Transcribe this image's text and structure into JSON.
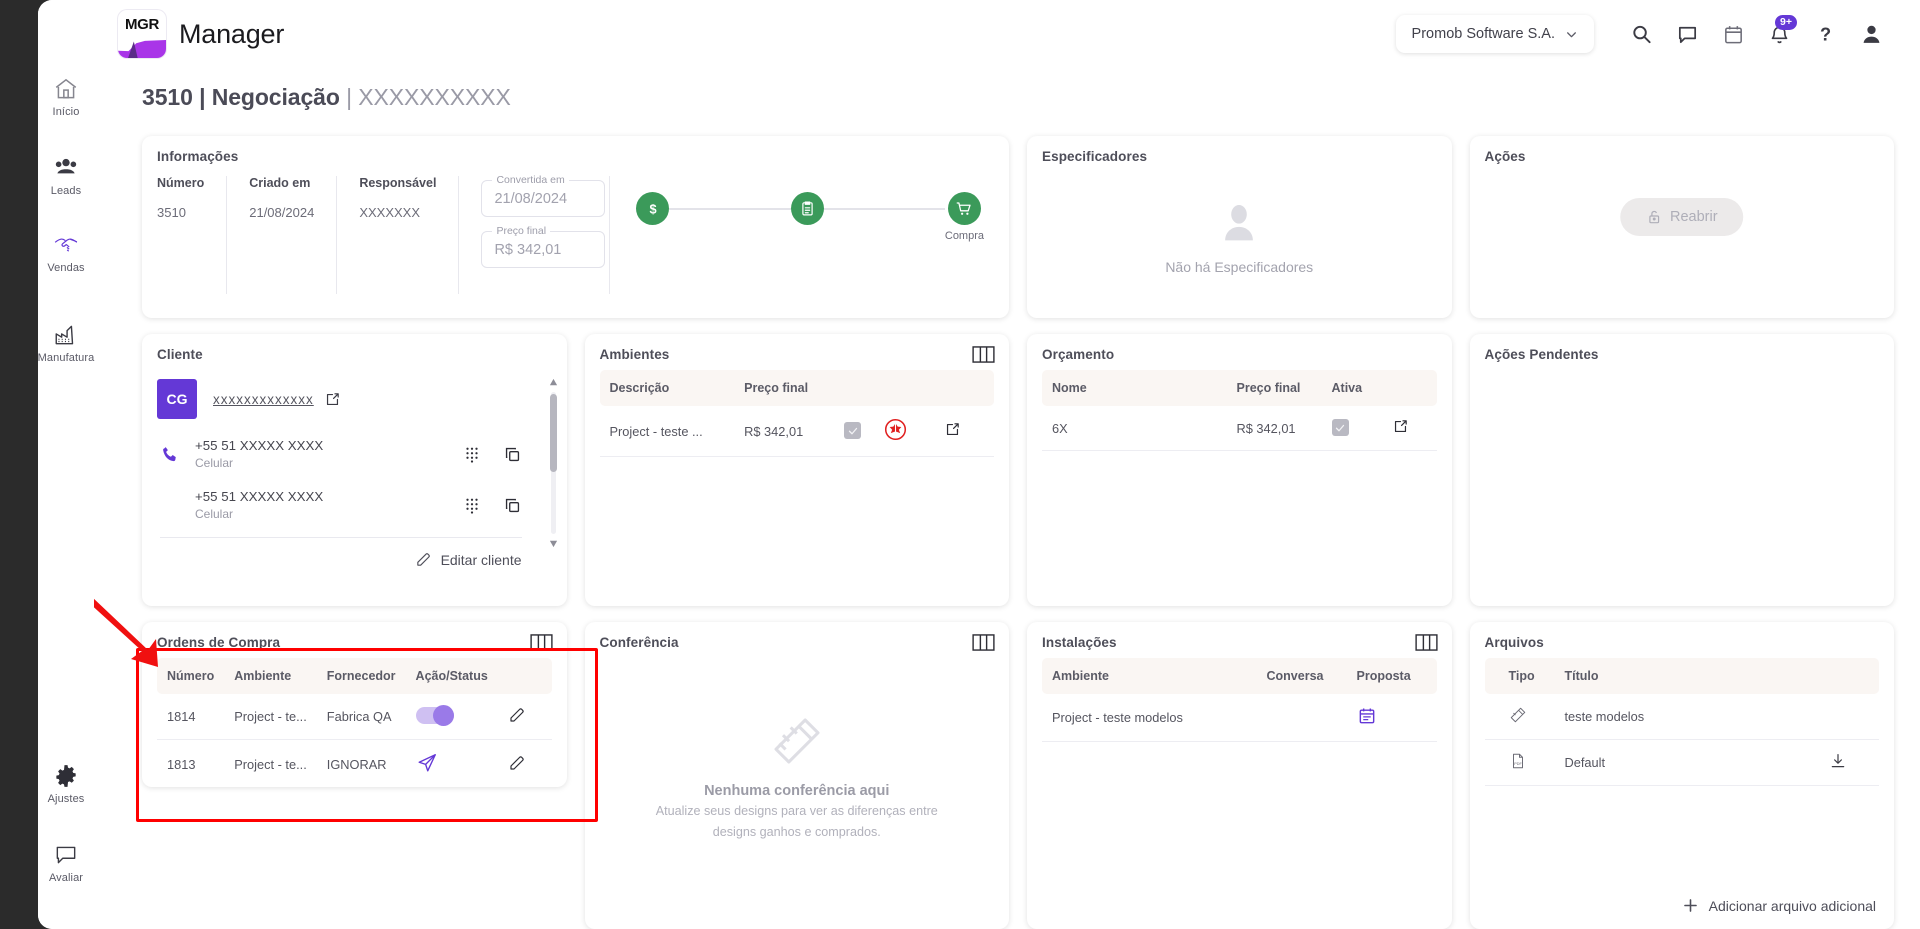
{
  "brand": {
    "logo_text": "MGR",
    "name": "Manager"
  },
  "header": {
    "org": "Promob Software S.A.",
    "chevron": "chevron-down-icon",
    "icons": [
      "search-icon",
      "chat-icon",
      "calendar-icon",
      "bell-icon",
      "help-icon",
      "user-icon"
    ],
    "notification_badge": "9+"
  },
  "sidebar": {
    "items": [
      {
        "label": "Início",
        "icon": "home-icon",
        "active": false
      },
      {
        "label": "Leads",
        "icon": "people-icon",
        "active": false
      },
      {
        "label": "Vendas",
        "icon": "handshake-icon",
        "active": true
      },
      {
        "label": "Manufatura",
        "icon": "factory-icon",
        "active": false
      },
      {
        "label": "Ajustes",
        "icon": "gear-icon",
        "active": false
      },
      {
        "label": "Avaliar",
        "icon": "feedback-icon",
        "active": false
      }
    ]
  },
  "page": {
    "title_number": "3510",
    "title_sep1": " | ",
    "title_stage": "Negociação",
    "title_sep2": " | ",
    "title_client": "XXXXXXXXXX"
  },
  "informacoes": {
    "title": "Informações",
    "columns": [
      {
        "header": "Número",
        "value": "3510"
      },
      {
        "header": "Criado em",
        "value": "21/08/2024"
      },
      {
        "header": "Responsável",
        "value": "XXXXXXX"
      }
    ],
    "fields": [
      {
        "label": "Convertida em",
        "value": "21/08/2024"
      },
      {
        "label": "Preço final",
        "value": "R$ 342,01"
      }
    ],
    "steps": [
      {
        "icon": "dollar-icon",
        "label": ""
      },
      {
        "icon": "clipboard-icon",
        "label": ""
      },
      {
        "icon": "cart-icon",
        "label": "Compra"
      }
    ],
    "step_color": "#3b9a5a"
  },
  "especificadores": {
    "title": "Especificadores",
    "empty_text": "Não há Especificadores",
    "empty_icon": "person-placeholder-icon"
  },
  "acoes": {
    "title": "Ações",
    "button_label": "Reabrir",
    "button_icon": "unlock-icon"
  },
  "acoes_pendentes": {
    "title": "Ações Pendentes"
  },
  "cliente": {
    "title": "Cliente",
    "initials": "CG",
    "avatar_color": "#6438d6",
    "name": "xxxxxxxxxxxxx",
    "open_icon": "external-link-icon",
    "phones": [
      {
        "number": "+55 51 XXXXX XXXX",
        "type": "Celular",
        "icon": "phone-icon",
        "actions": [
          "dialpad-icon",
          "copy-icon"
        ]
      },
      {
        "number": "+55 51 XXXXX XXXX",
        "type": "Celular",
        "icon": "",
        "actions": [
          "dialpad-icon",
          "copy-icon"
        ]
      }
    ],
    "edit_label": "Editar cliente",
    "edit_icon": "pencil-icon"
  },
  "ambientes": {
    "title": "Ambientes",
    "columns_icon": "columns-icon",
    "headers": [
      "Descrição",
      "Preço final",
      "",
      "",
      ""
    ],
    "rows": [
      {
        "descricao": "Project - teste ...",
        "preco": "R$ 342,01",
        "check": "check-icon",
        "status": "red-alert-icon",
        "open": "external-link-icon"
      }
    ]
  },
  "orcamento": {
    "title": "Orçamento",
    "headers": [
      "Nome",
      "Preço final",
      "Ativa",
      ""
    ],
    "rows": [
      {
        "nome": "6X",
        "preco": "R$ 342,01",
        "ativa": "check-icon",
        "open": "external-link-icon"
      }
    ]
  },
  "ordens_compra": {
    "title": "Ordens de Compra",
    "columns_icon": "columns-icon",
    "headers": [
      "Número",
      "Ambiente",
      "Fornecedor",
      "Ação/Status",
      ""
    ],
    "rows": [
      {
        "numero": "1814",
        "ambiente": "Project - te...",
        "fornecedor": "Fabrica QA",
        "acao": "toggle-on",
        "edit": "pencil-icon"
      },
      {
        "numero": "1813",
        "ambiente": "Project - te...",
        "fornecedor": "IGNORAR",
        "acao": "send-icon",
        "edit": "pencil-icon"
      }
    ],
    "highlight_color": "#ff0000"
  },
  "conferencia": {
    "title": "Conferência",
    "columns_icon": "columns-icon",
    "empty_icon": "pencil-ruler-icon",
    "empty_title": "Nenhuma conferência aqui",
    "empty_line1": "Atualize seus designs para ver as diferenças entre",
    "empty_line2": "designs ganhos e comprados."
  },
  "instalacoes": {
    "title": "Instalações",
    "columns_icon": "columns-icon",
    "headers": [
      "Ambiente",
      "Conversa",
      "Proposta"
    ],
    "rows": [
      {
        "ambiente": "Project - teste modelos",
        "conversa": "",
        "proposta": "calendar-purple-icon"
      }
    ]
  },
  "arquivos": {
    "title": "Arquivos",
    "headers": [
      "Tipo",
      "Título",
      ""
    ],
    "rows": [
      {
        "tipo": "design-icon",
        "titulo": "teste modelos",
        "action": ""
      },
      {
        "tipo": "pdf-icon",
        "titulo": "Default",
        "action": "download-icon"
      }
    ],
    "add_label": "Adicionar arquivo adicional",
    "add_icon": "plus-icon"
  }
}
